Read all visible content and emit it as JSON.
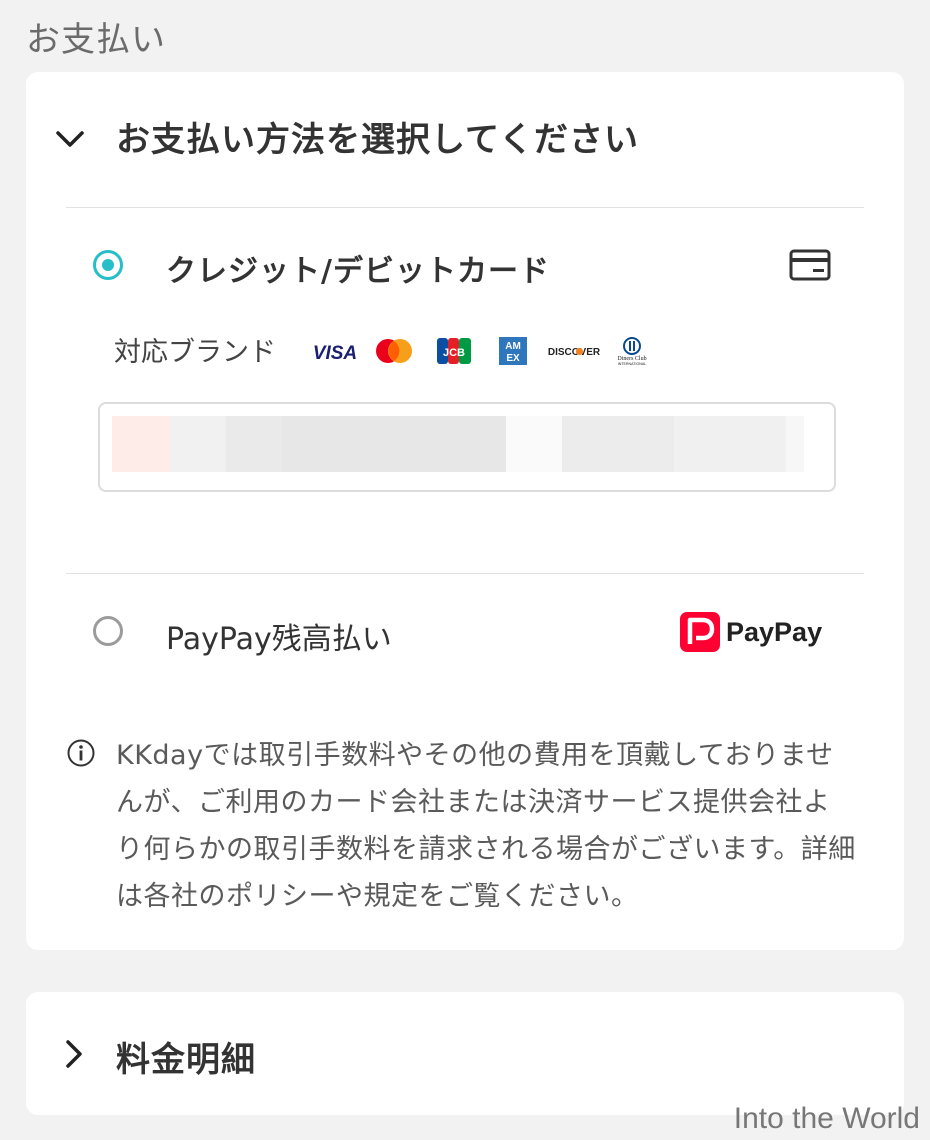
{
  "section_title": "お支払い",
  "payment_card": {
    "title": "お支払い方法を選択してください",
    "expanded": true,
    "options": [
      {
        "label": "クレジット/デビットカード",
        "selected": true,
        "icon": "credit-card-icon",
        "brands_label": "対応ブランド",
        "brands": [
          "VISA",
          "Mastercard",
          "JCB",
          "AMEX",
          "DISCOVER",
          "Diners Club"
        ],
        "brand_texts": {
          "visa": "VISA",
          "jcb": "JCB",
          "amex_top": "AM",
          "amex_bottom": "EX",
          "discover": "DISCOVER",
          "diners_top": "Diners Club",
          "diners_bottom": "INTERNATIONAL"
        }
      },
      {
        "label": "PayPay残高払い",
        "selected": false,
        "logo_text": "PayPay"
      }
    ],
    "notice": "KKdayでは取引手数料やその他の費用を頂戴しておりませんが、ご利用のカード会社または決済サービス提供会社より何らかの取引手数料を請求される場合がございます。詳細は各社のポリシーや規定をご覧ください。"
  },
  "fee_card": {
    "title": "料金明細",
    "expanded": false
  },
  "watermark": "Into the World",
  "colors": {
    "accent": "#26bec9",
    "paypay_red": "#ff0033",
    "visa_blue": "#1a1f71",
    "amex_blue": "#2e77bc"
  }
}
